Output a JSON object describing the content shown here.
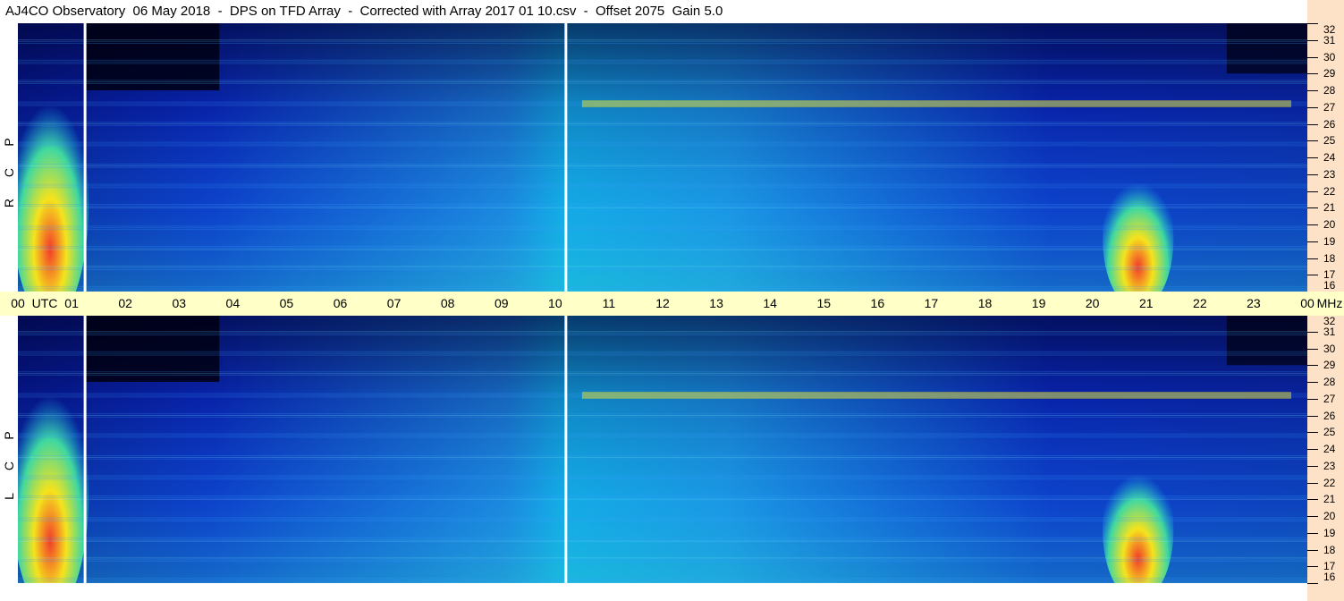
{
  "title": "AJ4CO Observatory  06 May 2018  -  DPS on TFD Array  -  Corrected with Array 2017 01 10.csv  -  Offset 2075  Gain 5.0",
  "chart_data": {
    "type": "heatmap",
    "x_unit": "UTC",
    "y_unit": "MHz",
    "time_axis": {
      "label": "UTC",
      "unit_label": "MHz",
      "ticks": [
        "00",
        "01",
        "02",
        "03",
        "04",
        "05",
        "06",
        "07",
        "08",
        "09",
        "10",
        "11",
        "12",
        "13",
        "14",
        "15",
        "16",
        "17",
        "18",
        "19",
        "20",
        "21",
        "22",
        "23",
        "00"
      ]
    },
    "freq_axis": {
      "range_mhz": [
        16,
        32
      ],
      "ticks": [
        "32",
        "31",
        "30",
        "29",
        "28",
        "27",
        "26",
        "25",
        "24",
        "23",
        "22",
        "21",
        "20",
        "19",
        "18",
        "17",
        "16"
      ]
    },
    "panels": [
      {
        "name": "RCP",
        "side_label": [
          "R",
          "C",
          "P"
        ],
        "data_gaps_utc": [
          1.25,
          10.2
        ],
        "features": [
          {
            "time_utc": [
              0,
              1.2
            ],
            "freq_mhz": [
              16,
              28
            ],
            "intensity": "high"
          },
          {
            "time_utc": [
              20.3,
              21.4
            ],
            "freq_mhz": [
              16,
              23
            ],
            "intensity": "high"
          },
          {
            "time_utc": [
              10.5,
              23.7
            ],
            "freq_mhz": [
              27,
              27.4
            ],
            "intensity": "band"
          }
        ]
      },
      {
        "name": "LCP",
        "side_label": [
          "L",
          "C",
          "P"
        ],
        "data_gaps_utc": [
          1.25,
          10.2
        ],
        "features": [
          {
            "time_utc": [
              0,
              1.2
            ],
            "freq_mhz": [
              16,
              28
            ],
            "intensity": "high"
          },
          {
            "time_utc": [
              20.3,
              21.4
            ],
            "freq_mhz": [
              16,
              23
            ],
            "intensity": "high"
          },
          {
            "time_utc": [
              10.5,
              23.7
            ],
            "freq_mhz": [
              27,
              27.4
            ],
            "intensity": "band"
          }
        ]
      }
    ],
    "colors": {
      "background_low": "#0a2bc8",
      "mid": "#12a6e8",
      "high": "#f5e31c",
      "peak": "#f23c2a",
      "dark": "#000010"
    }
  }
}
